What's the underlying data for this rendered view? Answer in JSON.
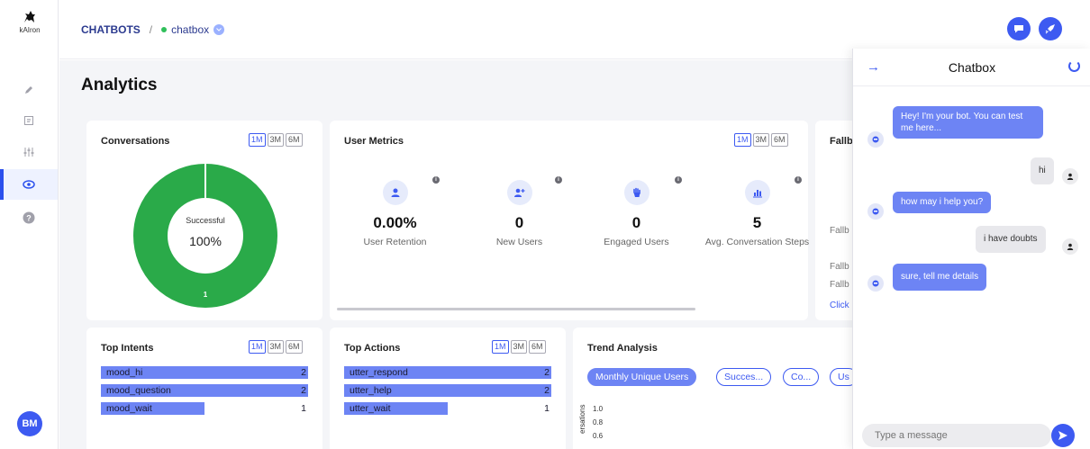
{
  "brand": {
    "logo_text": "kAIron"
  },
  "sidebar": {
    "items": [
      {
        "icon": "pencil-icon"
      },
      {
        "icon": "document-icon"
      },
      {
        "icon": "sliders-icon"
      },
      {
        "icon": "eye-icon",
        "active": true
      },
      {
        "icon": "help-icon"
      }
    ],
    "avatar_initials": "BM"
  },
  "header": {
    "breadcrumb_root": "CHATBOTS",
    "separator": "/",
    "bot_name": "chatbox",
    "actions": [
      {
        "icon": "chat-icon"
      },
      {
        "icon": "rocket-icon"
      }
    ]
  },
  "page": {
    "title": "Analytics"
  },
  "periods": [
    "1M",
    "3M",
    "6M"
  ],
  "conversations": {
    "title": "Conversations",
    "donut_label": "Successful",
    "donut_value": "100%",
    "donut_count": "1",
    "success_fraction": 1.0
  },
  "user_metrics": {
    "title": "User Metrics",
    "metrics": [
      {
        "value": "0.00%",
        "label": "User Retention",
        "icon": "user-icon"
      },
      {
        "value": "0",
        "label": "New Users",
        "icon": "user-plus-icon"
      },
      {
        "value": "0",
        "label": "Engaged Users",
        "icon": "hand-icon"
      },
      {
        "value": "5",
        "label": "Avg. Conversation Steps",
        "icon": "bar-chart-icon"
      }
    ]
  },
  "fallback": {
    "title": "Fallb",
    "lines": [
      "Fallb",
      "Fallb",
      "Fallb"
    ],
    "link": "Click"
  },
  "top_intents": {
    "title": "Top Intents",
    "rows": [
      {
        "label": "mood_hi",
        "count": "2",
        "fraction": 1.0
      },
      {
        "label": "mood_question",
        "count": "2",
        "fraction": 1.0
      },
      {
        "label": "mood_wait",
        "count": "1",
        "fraction": 0.5
      }
    ]
  },
  "top_actions": {
    "title": "Top Actions",
    "rows": [
      {
        "label": "utter_respond",
        "count": "2",
        "fraction": 1.0
      },
      {
        "label": "utter_help",
        "count": "2",
        "fraction": 1.0
      },
      {
        "label": "utter_wait",
        "count": "1",
        "fraction": 0.5
      }
    ]
  },
  "trend": {
    "title": "Trend Analysis",
    "chips": [
      "Monthly Unique Users",
      "Succes...",
      "Co...",
      "Us"
    ],
    "y_axis_label": "ersations",
    "y_ticks": [
      "1.0",
      "0.8",
      "0.6"
    ]
  },
  "chat": {
    "title": "Chatbox",
    "messages": [
      {
        "from": "bot",
        "text": "Hey! I'm your bot. You can test me here..."
      },
      {
        "from": "user",
        "text": "hi"
      },
      {
        "from": "bot",
        "text": "how may i help you?"
      },
      {
        "from": "user",
        "text": "i have doubts"
      },
      {
        "from": "bot",
        "text": "sure, tell me details"
      }
    ],
    "input_placeholder": "Type a message"
  }
}
